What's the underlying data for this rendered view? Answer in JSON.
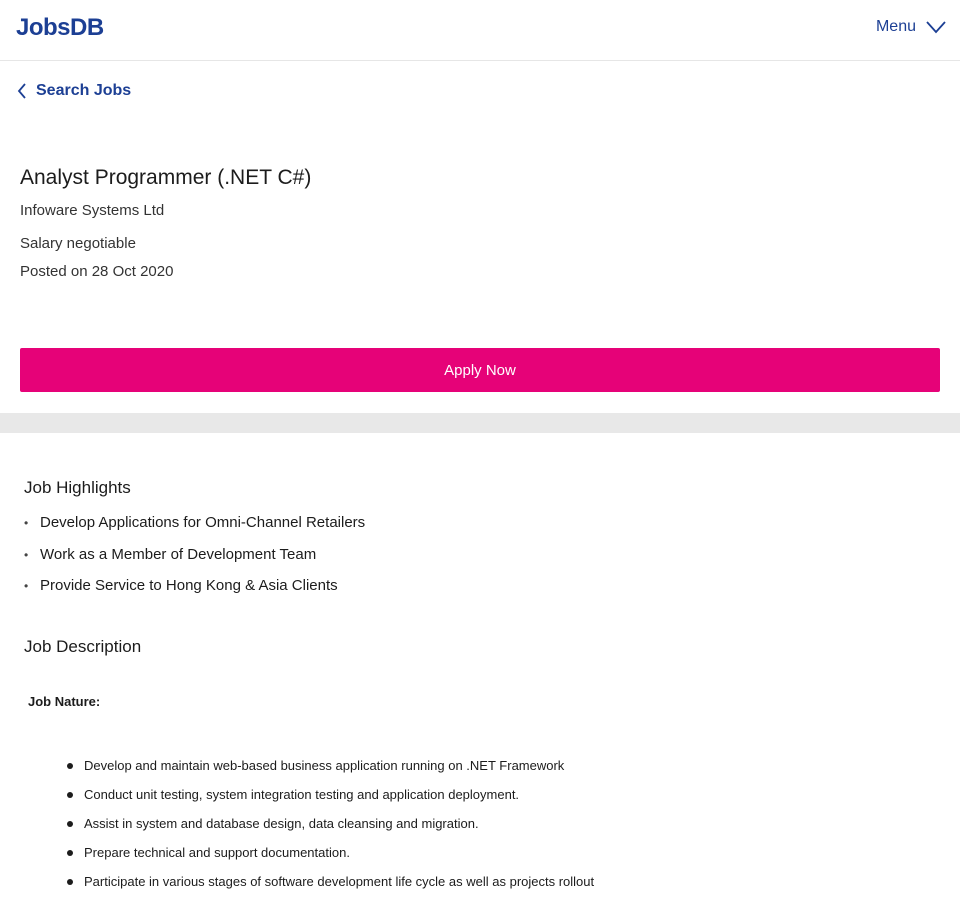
{
  "header": {
    "logo": "JobsDB",
    "menu_label": "Menu"
  },
  "nav": {
    "back_label": "Search Jobs"
  },
  "job": {
    "title": "Analyst Programmer (.NET C#)",
    "company": "Infoware Systems Ltd",
    "salary": "Salary negotiable",
    "posted": "Posted on 28 Oct 2020",
    "apply_label": "Apply Now"
  },
  "highlights": {
    "heading": "Job Highlights",
    "items": [
      "Develop Applications for Omni-Channel Retailers",
      "Work as a Member of Development Team",
      "Provide Service to Hong Kong & Asia Clients"
    ]
  },
  "description": {
    "heading": "Job Description",
    "nature_label": "Job Nature:",
    "items": [
      "Develop and maintain web-based business application running on .NET Framework",
      "Conduct unit testing, system integration testing and application deployment.",
      "Assist in system and database design, data cleansing and migration.",
      "Prepare technical and support documentation.",
      "Participate in various stages of software development life cycle as well as projects rollout"
    ]
  },
  "colors": {
    "brand": "#1c3f94",
    "apply_button": "#e60278"
  },
  "icons": {
    "menu": "chevron-down-icon",
    "back": "chevron-left-icon"
  }
}
